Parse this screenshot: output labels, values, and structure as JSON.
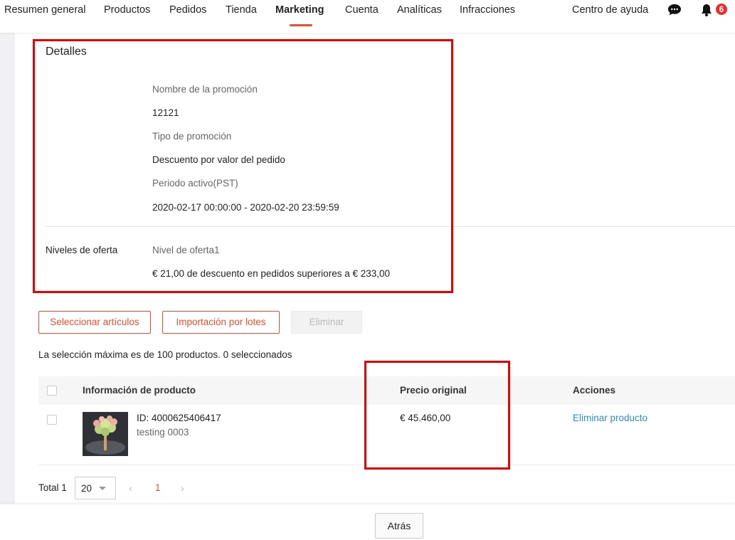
{
  "nav": {
    "items": [
      "Resumen general",
      "Productos",
      "Pedidos",
      "Tienda",
      "Marketing",
      "Cuenta",
      "Analíticas",
      "Infracciones"
    ],
    "help": "Centro de ayuda",
    "notification_count": "6",
    "accent_color": "#ee4d2d"
  },
  "details": {
    "title": "Detalles",
    "name_label": "Nombre de la promoción",
    "name_value": "12121",
    "type_label": "Tipo de promoción",
    "type_value": "Descuento por valor del pedido",
    "period_label": "Periodo activo(PST)",
    "period_value": "2020-02-17 00:00:00 - 2020-02-20 23:59:59",
    "tiers_label": "Niveles de oferta",
    "tier_label": "Nivel de oferta1",
    "tier_value": "€ 21,00 de descuento en pedidos superiores a € 233,00"
  },
  "actions": {
    "select_items": "Seleccionar artículos",
    "batch_import": "Importación por lotes",
    "delete": "Eliminar"
  },
  "selection_info": "La selección máxima es de 100 productos. 0 seleccionados",
  "table": {
    "headers": [
      "Información de producto",
      "Precio original",
      "Acciones"
    ],
    "rows": [
      {
        "id": "ID: 4000625406417",
        "name": "testing 0003",
        "price": "€ 45.460,00",
        "action": "Eliminar producto"
      }
    ]
  },
  "pagination": {
    "total": "Total 1",
    "page_size": "20",
    "current_page": "1"
  },
  "footer": {
    "back": "Atrás"
  }
}
